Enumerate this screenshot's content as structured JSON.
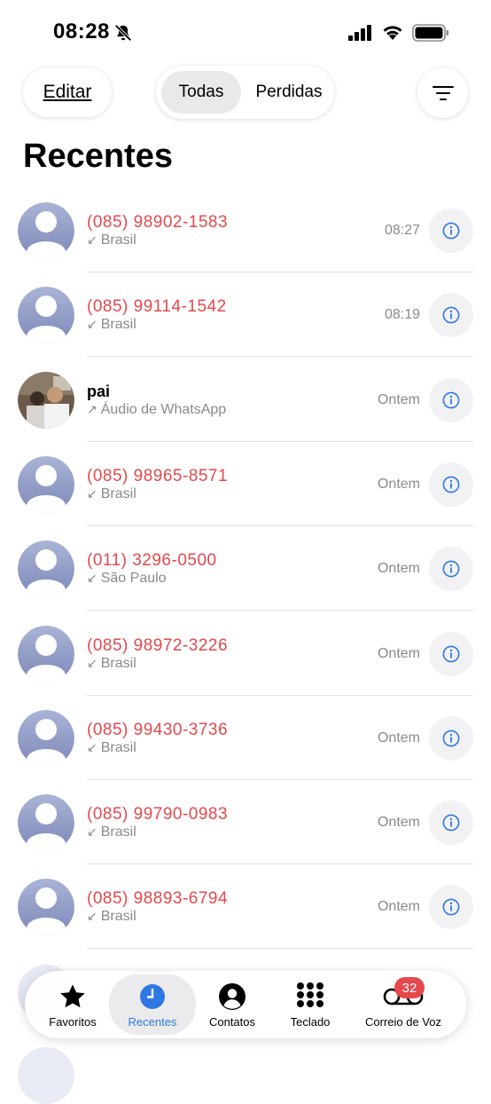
{
  "status_bar": {
    "time": "08:28"
  },
  "header": {
    "edit_label": "Editar",
    "filter_all": "Todas",
    "filter_missed": "Perdidas",
    "title": "Recentes"
  },
  "calls": [
    {
      "caller": "(085) 98902-1583",
      "detail": "Brasil",
      "time": "08:27",
      "missed": true,
      "direction": "incoming"
    },
    {
      "caller": "(085) 99114-1542",
      "detail": "Brasil",
      "time": "08:19",
      "missed": true,
      "direction": "incoming"
    },
    {
      "caller": "pai",
      "detail": "Áudio de WhatsApp",
      "time": "Ontem",
      "missed": false,
      "direction": "outgoing"
    },
    {
      "caller": "(085) 98965-8571",
      "detail": "Brasil",
      "time": "Ontem",
      "missed": true,
      "direction": "incoming"
    },
    {
      "caller": "(011) 3296-0500",
      "detail": "São Paulo",
      "time": "Ontem",
      "missed": true,
      "direction": "incoming"
    },
    {
      "caller": "(085) 98972-3226",
      "detail": "Brasil",
      "time": "Ontem",
      "missed": true,
      "direction": "incoming"
    },
    {
      "caller": "(085) 99430-3736",
      "detail": "Brasil",
      "time": "Ontem",
      "missed": true,
      "direction": "incoming"
    },
    {
      "caller": "(085) 99790-0983",
      "detail": "Brasil",
      "time": "Ontem",
      "missed": true,
      "direction": "incoming"
    },
    {
      "caller": "(085) 98893-6794",
      "detail": "Brasil",
      "time": "Ontem",
      "missed": true,
      "direction": "incoming"
    }
  ],
  "tab_bar": {
    "favorites": "Favoritos",
    "recents": "Recentes",
    "contacts": "Contatos",
    "keypad": "Teclado",
    "voicemail": "Correio de Voz",
    "voicemail_badge": "32"
  },
  "colors": {
    "missed": "#e5484d",
    "accent": "#2f78e4",
    "secondary_text": "#8a8a8e",
    "avatar_gradient_top": "#a9b4d6",
    "avatar_gradient_bottom": "#7d89b8"
  },
  "icons": {
    "incoming_arrow": "↙",
    "outgoing_arrow": "↗"
  }
}
